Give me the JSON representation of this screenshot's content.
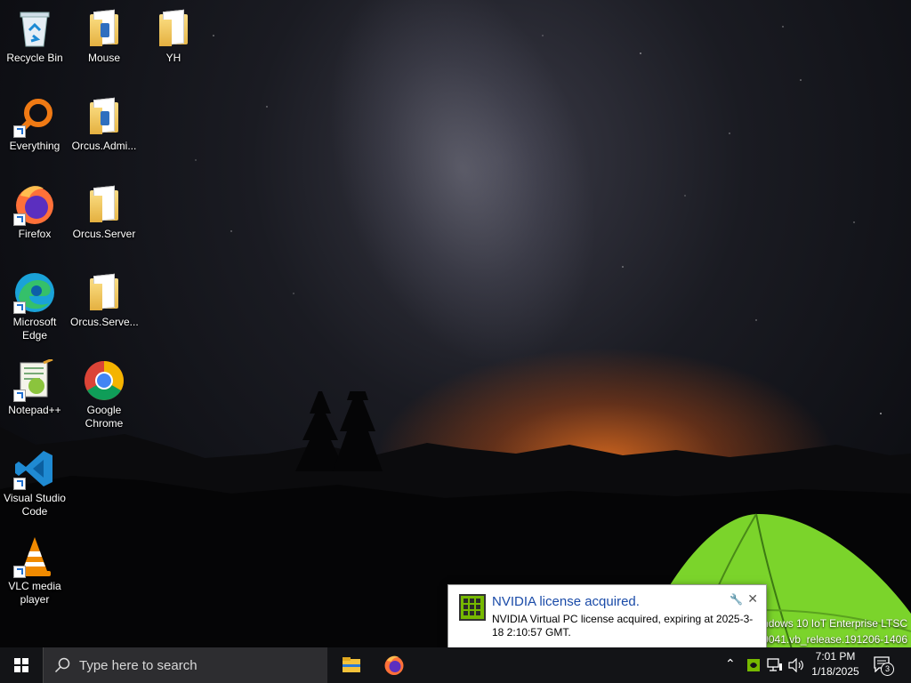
{
  "desktop": {
    "icons": [
      {
        "label": "Recycle Bin",
        "icon": "recycle-bin-icon"
      },
      {
        "label": "Mouse",
        "icon": "folder-icon"
      },
      {
        "label": "YH",
        "icon": "folder-icon"
      },
      {
        "label": "Everything",
        "icon": "everything-search-icon"
      },
      {
        "label": "Orcus.Admi...",
        "icon": "folder-icon"
      },
      {
        "label": "Firefox",
        "icon": "firefox-icon"
      },
      {
        "label": "Orcus.Server",
        "icon": "folder-icon"
      },
      {
        "label": "Microsoft Edge",
        "icon": "edge-icon"
      },
      {
        "label": "Orcus.Serve...",
        "icon": "folder-icon"
      },
      {
        "label": "Notepad++",
        "icon": "notepadpp-icon"
      },
      {
        "label": "Google Chrome",
        "icon": "chrome-icon"
      },
      {
        "label": "Visual Studio Code",
        "icon": "vscode-icon"
      },
      {
        "label": "VLC media player",
        "icon": "vlc-icon"
      }
    ]
  },
  "notification": {
    "title": "NVIDIA license acquired.",
    "body": "NVIDIA Virtual PC license acquired, expiring at 2025-3-18 2:10:57 GMT.",
    "icon": "nvidia-icon"
  },
  "watermark": {
    "line1": "indows 10 IoT Enterprise LTSC",
    "line2": "19041.vb_release.191206-1406"
  },
  "taskbar": {
    "search_placeholder": "Type here to search",
    "pinned": [
      {
        "name": "File Explorer",
        "icon": "file-explorer-icon"
      },
      {
        "name": "Firefox",
        "icon": "firefox-icon"
      }
    ],
    "time": "7:01 PM",
    "date": "1/18/2025",
    "notification_count": "3"
  },
  "colors": {
    "taskbar": "#131417",
    "search_box": "#2d2d30",
    "toast_title": "#1a4ba8",
    "accent_green": "#76b900"
  }
}
